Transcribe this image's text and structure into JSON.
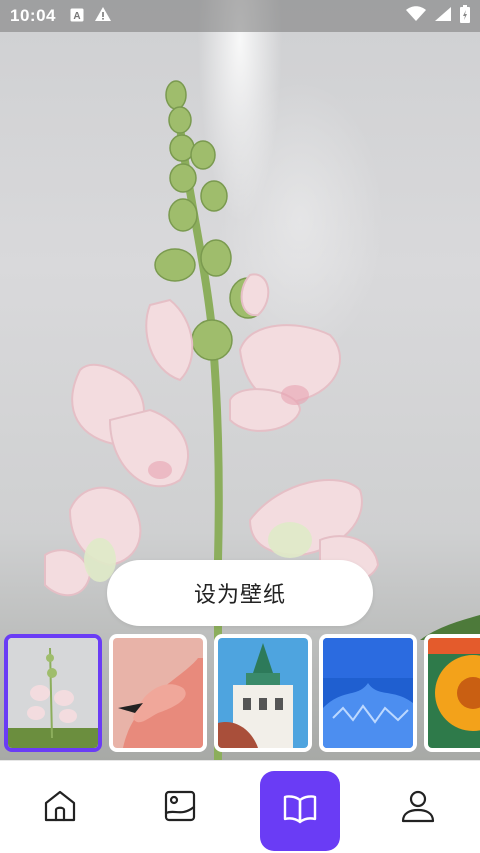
{
  "status_bar": {
    "time": "10:04",
    "left_icons": [
      "a-badge-icon",
      "warning-icon"
    ],
    "right_icons": [
      "wifi-icon",
      "signal-icon",
      "battery-icon"
    ]
  },
  "wallpaper": {
    "subject": "flower-image"
  },
  "actions": {
    "set_wallpaper_label": "设为壁纸"
  },
  "thumbnails": [
    {
      "name": "thumb-flower",
      "selected": true
    },
    {
      "name": "thumb-flamingo",
      "selected": false
    },
    {
      "name": "thumb-church",
      "selected": false
    },
    {
      "name": "thumb-blue-ice",
      "selected": false
    },
    {
      "name": "thumb-sunflower",
      "selected": false
    }
  ],
  "bottom_nav": {
    "items": [
      {
        "icon": "home-icon",
        "active": false
      },
      {
        "icon": "gallery-icon",
        "active": false
      },
      {
        "icon": "book-icon",
        "active": true
      },
      {
        "icon": "profile-icon",
        "active": false
      }
    ],
    "accent_color": "#6a3cf5"
  }
}
